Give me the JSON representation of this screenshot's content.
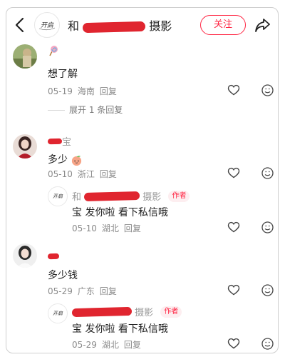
{
  "header": {
    "title_prefix": "和",
    "title_suffix": "摄影",
    "follow_label": "关注",
    "logo_text": "开启"
  },
  "comments": [
    {
      "text": "想了解",
      "date": "05-19",
      "location": "海南",
      "reply_label": "回复",
      "expand_label": "展开 1 条回复"
    },
    {
      "name_suffix": "宝",
      "text": "多少",
      "date": "05-10",
      "location": "浙江",
      "reply_label": "回复",
      "reply": {
        "name_prefix": "和",
        "name_suffix": "摄影",
        "tag": "作者",
        "text": "宝 发你啦 看下私信哦",
        "date": "05-10",
        "location": "湖北",
        "reply_label": "回复"
      }
    },
    {
      "text": "多少钱",
      "date": "05-29",
      "location": "广东",
      "reply_label": "回复",
      "reply": {
        "name_suffix": "摄影",
        "tag": "作者",
        "text": "宝 发你啦 看下私信哦",
        "date": "05-29",
        "location": "湖北",
        "reply_label": "回复"
      }
    }
  ],
  "colors": {
    "accent": "#ff2442",
    "redaction": "#e0252f",
    "meta_text": "#8a8a8a"
  },
  "icons": [
    "back-arrow-icon",
    "share-arrow-icon",
    "heart-icon",
    "smiley-icon",
    "lollipop-emoji-icon",
    "peach-emoji-icon"
  ]
}
